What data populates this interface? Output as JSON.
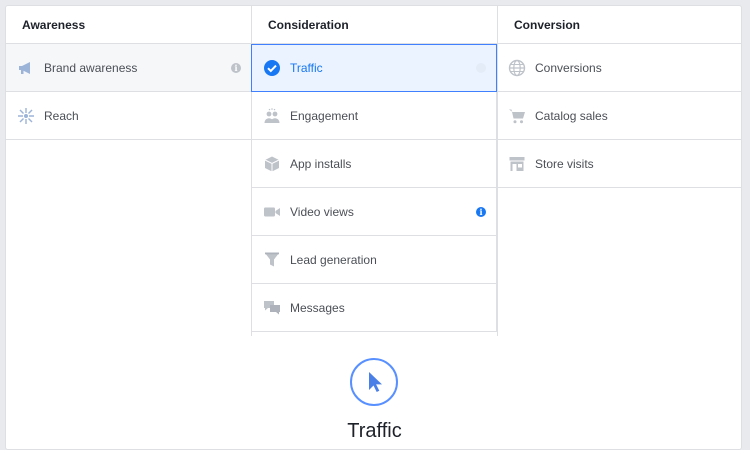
{
  "columns": [
    {
      "title": "Awareness",
      "items": [
        {
          "label": "Brand awareness",
          "icon": "megaphone-icon"
        },
        {
          "label": "Reach",
          "icon": "reach-burst-icon"
        }
      ]
    },
    {
      "title": "Consideration",
      "items": [
        {
          "label": "Traffic",
          "icon": "checkmark-circle-icon"
        },
        {
          "label": "Engagement",
          "icon": "people-icon"
        },
        {
          "label": "App installs",
          "icon": "box-icon"
        },
        {
          "label": "Video views",
          "icon": "video-camera-icon"
        },
        {
          "label": "Lead generation",
          "icon": "funnel-icon"
        },
        {
          "label": "Messages",
          "icon": "chat-bubbles-icon"
        }
      ]
    },
    {
      "title": "Conversion",
      "items": [
        {
          "label": "Conversions",
          "icon": "globe-icon"
        },
        {
          "label": "Catalog sales",
          "icon": "shopping-cart-icon"
        },
        {
          "label": "Store visits",
          "icon": "storefront-icon"
        }
      ]
    }
  ],
  "selected": "Traffic",
  "detail": {
    "title": "Traffic",
    "icon": "cursor-arrow-icon"
  },
  "colors": {
    "accent": "#1877f2",
    "selected_bg": "#eaf3ff",
    "icon_grey": "#bec2c9",
    "border": "#dddfe2"
  }
}
